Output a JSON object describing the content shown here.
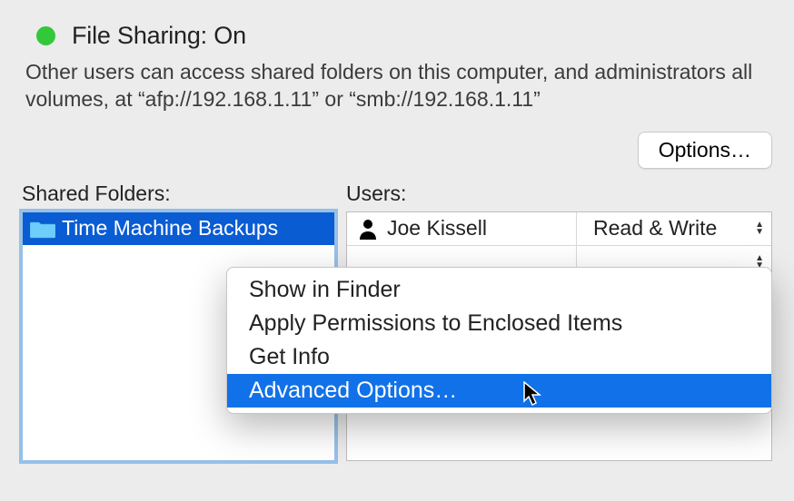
{
  "status": {
    "title": "File Sharing: On",
    "indicator_color": "#33c83a"
  },
  "description": "Other users can access shared folders on this computer, and administrators all volumes, at “afp://192.168.1.11” or “smb://192.168.1.11”",
  "options_button": "Options…",
  "shared_folders": {
    "label": "Shared Folders:",
    "items": [
      {
        "name": "Time Machine Backups",
        "selected": true
      }
    ]
  },
  "users": {
    "label": "Users:",
    "rows": [
      {
        "name": "Joe Kissell",
        "permission": "Read & Write"
      }
    ]
  },
  "context_menu": {
    "items": [
      {
        "label": "Show in Finder",
        "highlighted": false
      },
      {
        "label": "Apply Permissions to Enclosed Items",
        "highlighted": false
      },
      {
        "label": "Get Info",
        "highlighted": false
      },
      {
        "label": "Advanced Options…",
        "highlighted": true
      }
    ]
  }
}
